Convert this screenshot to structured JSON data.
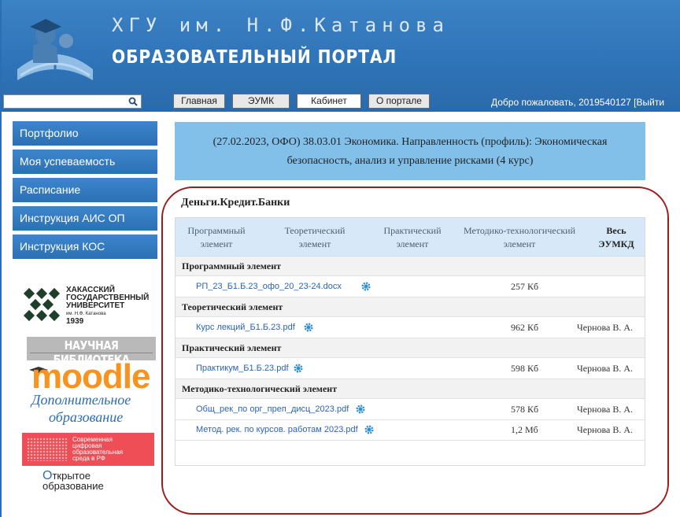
{
  "header": {
    "university": "ХГУ им. Н.Ф.Катанова",
    "portal": "ОБРАЗОВАТЕЛЬНЫЙ ПОРТАЛ",
    "search_value": "",
    "nav": [
      "Главная",
      "ЭУМК",
      "Кабинет",
      "О портале"
    ],
    "active_nav": "Кабинет",
    "welcome": "Добро пожаловать, 2019540127 [Выйти"
  },
  "sidebar": {
    "items": [
      "Портфолио",
      "Моя успеваемость",
      "Расписание",
      "Инструкция АИС ОП",
      "Инструкция КОС"
    ]
  },
  "logos": {
    "khsu": [
      "ХАКАССКИЙ",
      "ГОСУДАРСТВЕННЫЙ",
      "УНИВЕРСИТЕТ",
      "им. Н.Ф. Катанова",
      "1939"
    ],
    "library": "НАУЧНАЯ БИБЛИОТЕКА",
    "moodle": "moodle",
    "dop_line1": "Дополнительное",
    "dop_line2": "образование",
    "digital": [
      "Современная",
      "цифровая",
      "образовательная",
      "среда в РФ"
    ],
    "open_u": "О",
    "open_rest": "ткрытое",
    "open_line2": "образование"
  },
  "main": {
    "course": "(27.02.2023, ОФО) 38.03.01 Экономика. Направленность (профиль): Экономическая безопасность, анализ и управление рисками (4 курс)",
    "discipline": "Деньги.Кредит.Банки",
    "columns": [
      [
        "Программный",
        "элемент"
      ],
      [
        "Теоретический",
        "элемент"
      ],
      [
        "Практический",
        "элемент"
      ],
      [
        "Методико-технологический",
        "элемент"
      ],
      [
        "Весь",
        "ЭУМКД"
      ]
    ],
    "sections": [
      {
        "title": "Программный элемент",
        "files": [
          {
            "name": "РП_23_Б1.Б.23_офо_20_23-24.docx",
            "size": "257 Кб",
            "author": ""
          }
        ]
      },
      {
        "title": "Теоретический элемент",
        "files": [
          {
            "name": "Курс лекций_Б1.Б.23.pdf",
            "size": "962 Кб",
            "author": "Чернова В. А."
          }
        ]
      },
      {
        "title": "Практический элемент",
        "files": [
          {
            "name": "Практикум_Б1.Б.23.pdf",
            "size": "598 Кб",
            "author": "Чернова В. А."
          }
        ]
      },
      {
        "title": "Методико-технологический элемент",
        "files": [
          {
            "name": "Общ_рек_по орг_преп_дисц_2023.pdf",
            "size": "578 Кб",
            "author": "Чернова В. А."
          },
          {
            "name": "Метод. рек. по курсов. работам 2023.pdf",
            "size": "1,2 Мб",
            "author": "Чернова В. А."
          }
        ]
      }
    ]
  },
  "colors": {
    "header_blue": "#2f74b8",
    "sidebar_blue": "#3179bf",
    "course_box": "#82c0ea",
    "table_head": "#d7e9f8",
    "link": "#2b64b0",
    "annotation": "#9e1b1b"
  }
}
